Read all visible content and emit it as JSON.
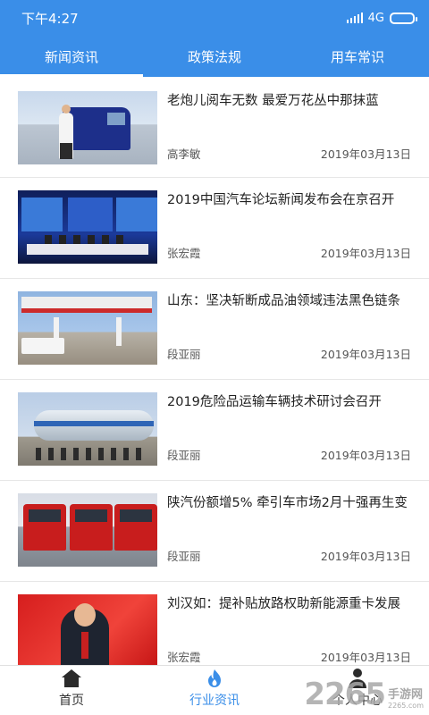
{
  "status_bar": {
    "time": "下午4:27",
    "network": "4G"
  },
  "tabs": [
    {
      "label": "新闻资讯",
      "active": true
    },
    {
      "label": "政策法规",
      "active": false
    },
    {
      "label": "用车常识",
      "active": false
    }
  ],
  "news": [
    {
      "title": "老炮儿阅车无数 最爱万花丛中那抹蓝",
      "author": "高李敏",
      "date": "2019年03月13日"
    },
    {
      "title": "2019中国汽车论坛新闻发布会在京召开",
      "author": "张宏霞",
      "date": "2019年03月13日"
    },
    {
      "title": "山东：坚决斩断成品油领域违法黑色链条",
      "author": "段亚丽",
      "date": "2019年03月13日"
    },
    {
      "title": "2019危险品运输车辆技术研讨会召开",
      "author": "段亚丽",
      "date": "2019年03月13日"
    },
    {
      "title": "陕汽份额增5% 牵引车市场2月十强再生变",
      "author": "段亚丽",
      "date": "2019年03月13日"
    },
    {
      "title": "刘汉如：提补贴放路权助新能源重卡发展",
      "author": "张宏霞",
      "date": "2019年03月13日"
    }
  ],
  "bottom_nav": [
    {
      "label": "首页",
      "icon": "home-icon"
    },
    {
      "label": "行业资讯",
      "icon": "flame-icon",
      "active": true
    },
    {
      "label": "个人中心",
      "icon": "person-icon"
    }
  ],
  "watermark": {
    "brand": "2265",
    "site": "手游网",
    "url": "2265.com"
  },
  "colors": {
    "primary": "#3a8ee8",
    "text": "#222222",
    "meta": "#555555"
  }
}
